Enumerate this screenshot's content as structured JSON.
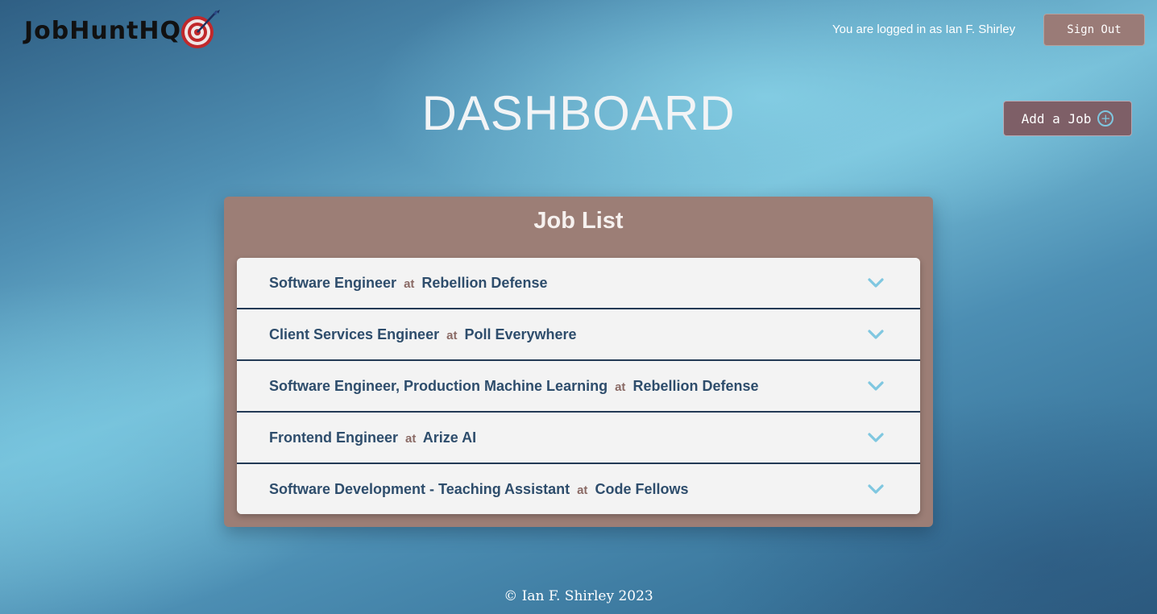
{
  "header": {
    "logo_text": "JobHuntHQ",
    "logged_in_text": "You are logged in as Ian F. Shirley",
    "signout_label": "Sign Out"
  },
  "main": {
    "title": "DASHBOARD",
    "add_job_label": "Add a Job",
    "add_icon": "plus-circle-icon"
  },
  "job_list": {
    "title": "Job List",
    "connector": "at",
    "items": [
      {
        "role": "Software Engineer",
        "company": "Rebellion Defense"
      },
      {
        "role": "Client Services Engineer",
        "company": "Poll Everywhere"
      },
      {
        "role": "Software Engineer, Production Machine Learning",
        "company": "Rebellion Defense"
      },
      {
        "role": "Frontend Engineer",
        "company": "Arize AI"
      },
      {
        "role": "Software Development - Teaching Assistant",
        "company": "Code Fellows"
      }
    ],
    "expand_icon": "chevron-down-icon"
  },
  "footer": {
    "copyright": "© Ian F. Shirley 2023"
  },
  "colors": {
    "panel": "#9c7e76",
    "item_text": "#2e4d6c",
    "connector_text": "#8a6a65",
    "chevron": "#7fc7e0",
    "signout_bg": "#9a7b77",
    "add_job_bg": "#7e5f67"
  }
}
